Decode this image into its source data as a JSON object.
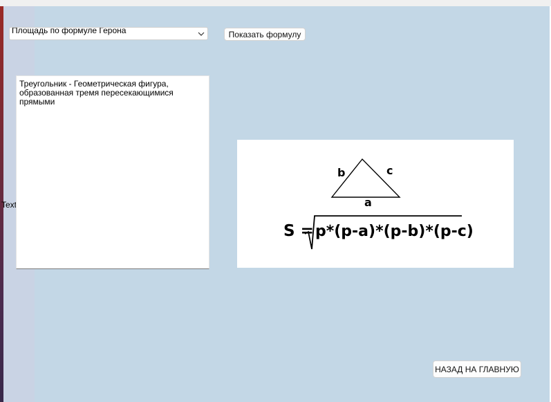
{
  "form": {
    "method_select": {
      "value": "Площадь по формуле Герона",
      "icon": "chevron-down-icon"
    },
    "show_formula_label": "Показать формулу",
    "side_label": "Text",
    "description_text": "Треугольник - Геометрическая фигура,\nобразованная тремя пересекающимися прямыми",
    "back_home_label": "НАЗАД НА ГЛАВНУЮ"
  },
  "formula_image": {
    "side_a": "a",
    "side_b": "b",
    "side_c": "c",
    "lhs": "S =",
    "radicand": "p*(p-a)*(p-b)*(p-c)"
  },
  "colors": {
    "background": "#c3d7e6",
    "left_pane": "#c9d3e4",
    "window_edge": "#9a2a26"
  }
}
